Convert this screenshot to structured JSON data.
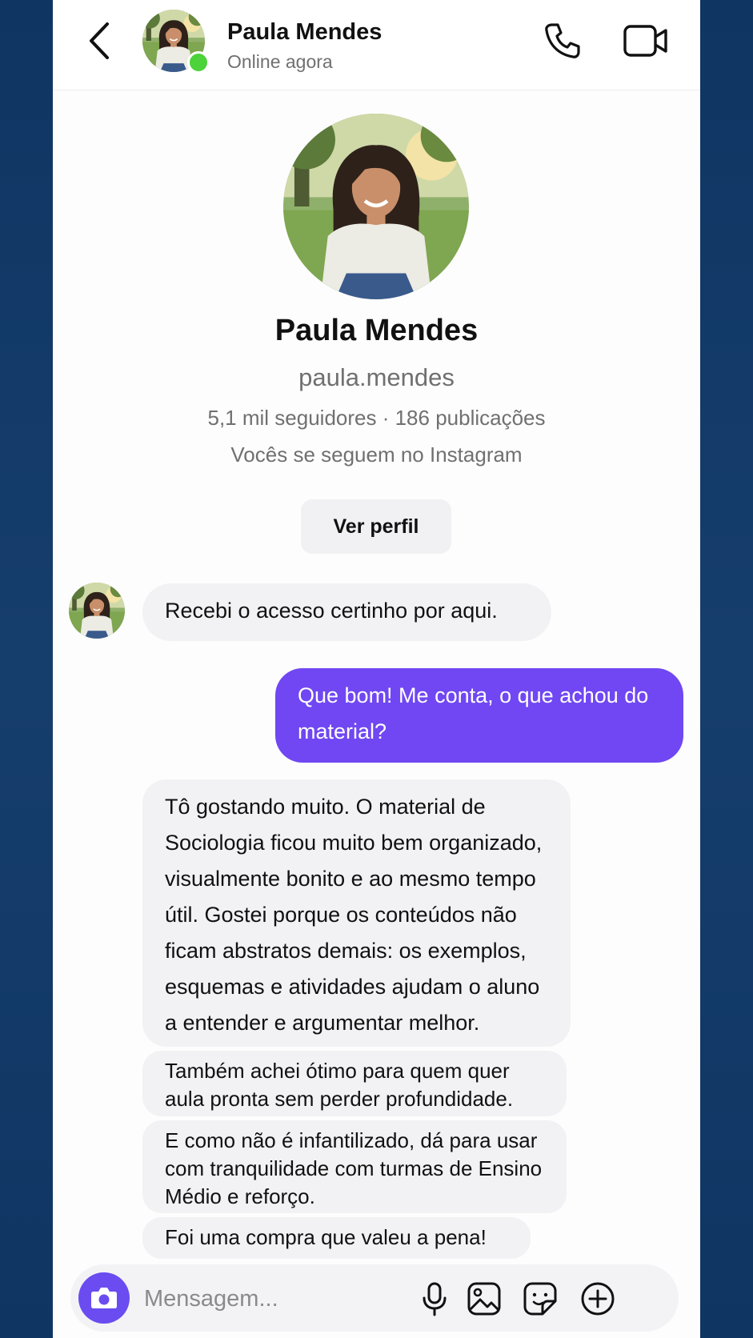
{
  "header": {
    "name": "Paula Mendes",
    "status": "Online agora",
    "icons": [
      "back-chevron-icon",
      "phone-icon",
      "video-camera-icon"
    ]
  },
  "profile": {
    "name": "Paula Mendes",
    "handle": "paula.mendes",
    "stats": "5,1 mil seguidores · 186 publicações",
    "mutual": "Vocês se seguem no Instagram",
    "view_profile_label": "Ver perfil"
  },
  "messages": [
    {
      "from": "them",
      "text": "Recebi o acesso certinho por aqui."
    },
    {
      "from": "me",
      "text": "Que bom! Me conta, o que achou do material?"
    },
    {
      "from": "them",
      "text": "Tô gostando muito. O material de Sociologia ficou muito bem organizado, visualmente bonito e ao mesmo tempo útil. Gostei porque os conteúdos não ficam abstratos demais: os exemplos, esquemas e atividades ajudam o aluno a entender e argumentar melhor."
    },
    {
      "from": "them",
      "text": "Também achei ótimo para quem quer aula pronta sem perder profundidade."
    },
    {
      "from": "them",
      "text": "E como não é infantilizado, dá para usar com tranquilidade com turmas de Ensino Médio e reforço."
    },
    {
      "from": "them",
      "text": "Foi uma compra que valeu a pena!"
    }
  ],
  "composer": {
    "placeholder": "Mensagem...",
    "icons": [
      "camera-icon",
      "microphone-icon",
      "gallery-icon",
      "sticker-icon",
      "plus-circle-icon"
    ]
  },
  "colors": {
    "accent": "#7047f2",
    "online": "#4cd23a",
    "incoming_bubble": "#f2f2f4",
    "background": "#143a66"
  }
}
